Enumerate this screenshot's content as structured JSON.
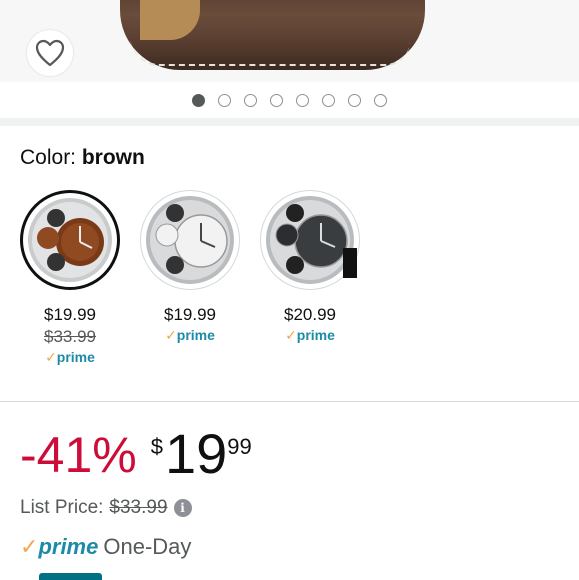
{
  "carousel": {
    "dot_count": 8,
    "active_index": 0
  },
  "variation": {
    "label": "Color: ",
    "selected_value": "brown",
    "options": [
      {
        "name": "brown-face",
        "price": "$19.99",
        "list_price": "$33.99",
        "prime": "prime",
        "selected": true
      },
      {
        "name": "silver-face",
        "price": "$19.99",
        "list_price": "",
        "prime": "prime",
        "selected": false
      },
      {
        "name": "black-face",
        "price": "$20.99",
        "list_price": "",
        "prime": "prime",
        "selected": false
      }
    ]
  },
  "price": {
    "discount": "-41%",
    "currency": "$",
    "whole": "19",
    "fraction": "99"
  },
  "list_price": {
    "label": "List Price:",
    "value": "$33.99",
    "info_icon": "info-icon"
  },
  "delivery": {
    "prime_label": "prime",
    "speed": "One-Day"
  },
  "colors": {
    "discount": "#cc0c39",
    "prime_blue": "#1d8ba8",
    "prime_check": "#f3a847",
    "link_teal": "#007185"
  }
}
